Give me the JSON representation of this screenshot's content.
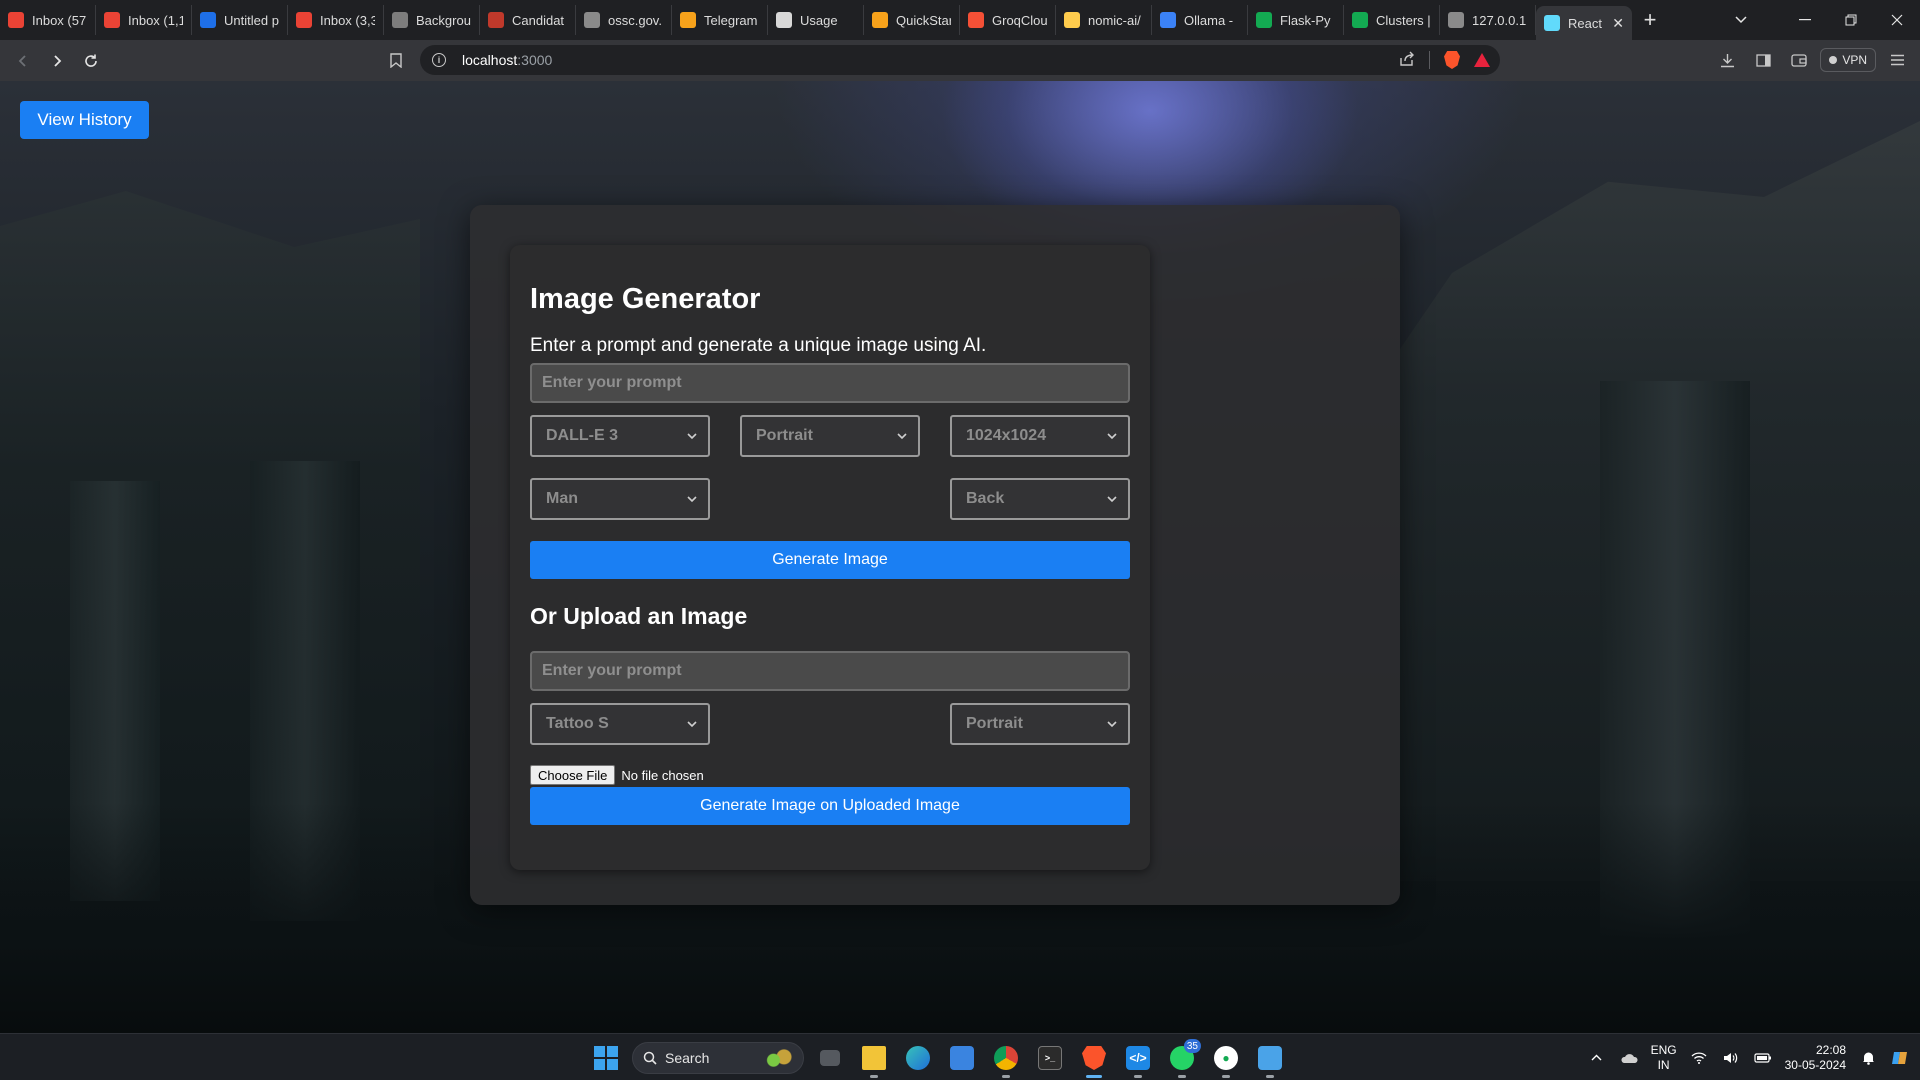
{
  "browser": {
    "tabs": [
      {
        "title": "Inbox (57",
        "favicon": "gmail-icon",
        "color": "#ea4335"
      },
      {
        "title": "Inbox (1,1",
        "favicon": "gmail-icon",
        "color": "#ea4335"
      },
      {
        "title": "Untitled p",
        "favicon": "butterfly-icon",
        "color": "#1e6fe8"
      },
      {
        "title": "Inbox (3,3",
        "favicon": "gmail-icon",
        "color": "#ea4335"
      },
      {
        "title": "Backgrou",
        "favicon": "openai-icon",
        "color": "#7d7d7d"
      },
      {
        "title": "Candidat",
        "favicon": "doc-icon",
        "color": "#c0392b"
      },
      {
        "title": "ossc.gov.",
        "favicon": "globe-icon",
        "color": "#8a8a8a"
      },
      {
        "title": "Telegram",
        "favicon": "infinity-icon",
        "color": "#f7a21b"
      },
      {
        "title": "Usage",
        "favicon": "claude-icon",
        "color": "#d8d8d8"
      },
      {
        "title": "QuickStar",
        "favicon": "infinity-icon",
        "color": "#f7a21b"
      },
      {
        "title": "GroqClou",
        "favicon": "groq-icon",
        "color": "#f55036"
      },
      {
        "title": "nomic-ai/",
        "favicon": "huggingface-icon",
        "color": "#ffcc4d"
      },
      {
        "title": "Ollama - ",
        "favicon": "cursor-icon",
        "color": "#3b82f6"
      },
      {
        "title": "Flask-Py",
        "favicon": "mongodb-leaf-icon",
        "color": "#13aa52"
      },
      {
        "title": "Clusters |",
        "favicon": "mongodb-leaf-icon",
        "color": "#13aa52"
      },
      {
        "title": "127.0.0.1",
        "favicon": "globe-icon",
        "color": "#8a8a8a"
      },
      {
        "title": "React",
        "favicon": "react-icon",
        "color": "#61dafb",
        "active": true
      }
    ],
    "address": {
      "host": "localhost",
      "port": ":3000"
    },
    "vpn_label": "VPN"
  },
  "page": {
    "history_button": "View History",
    "title": "Image Generator",
    "subtitle": "Enter a prompt and generate a unique image using AI.",
    "prompt_placeholder": "Enter your prompt",
    "model_select": "DALL-E 3",
    "orientation_select": "Portrait",
    "size_select": "1024x1024",
    "subject_select": "Man",
    "view_select": "Back",
    "generate_button": "Generate Image",
    "upload_heading": "Or Upload an Image",
    "upload_prompt_placeholder": "Enter your prompt",
    "style_select": "Tattoo S",
    "upload_orientation_select": "Portrait",
    "choose_file_button": "Choose File",
    "file_status": "No file chosen",
    "upload_generate_button": "Generate Image on Uploaded Image",
    "accent_color": "#1a7ff3"
  },
  "taskbar": {
    "search_label": "Search",
    "whatsapp_badge": "35",
    "language": "ENG",
    "region": "IN",
    "time": "22:08",
    "date": "30-05-2024"
  }
}
